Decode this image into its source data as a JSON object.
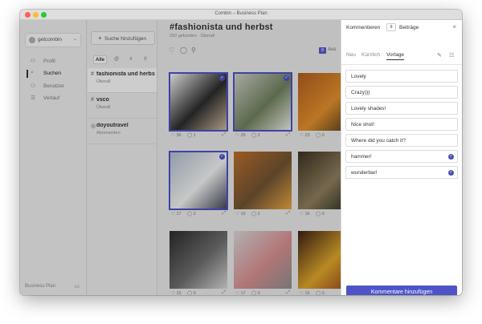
{
  "window": {
    "title": "Combin – Business Plan"
  },
  "sidebar": {
    "account": "getcombin",
    "items": [
      {
        "label": "Profil",
        "icon": "person-icon",
        "glyph": "⚇",
        "active": false
      },
      {
        "label": "Suchen",
        "icon": "search-icon",
        "glyph": "⌕",
        "active": true
      },
      {
        "label": "Benutzer",
        "icon": "users-icon",
        "glyph": "⚇",
        "active": false
      },
      {
        "label": "Verlauf",
        "icon": "list-icon",
        "glyph": "☰",
        "active": false
      }
    ],
    "footer": "Business Plan"
  },
  "searches": {
    "add_label": "Suche hinzufügen",
    "filters": [
      "Alle",
      "@",
      "#",
      "⚲"
    ],
    "items": [
      {
        "prefix": "#",
        "name": "fashionista und herbst",
        "sub": "Überall",
        "active": true
      },
      {
        "prefix": "#",
        "name": "vsco",
        "sub": "Überall",
        "active": false
      },
      {
        "prefix": "◎",
        "name": "doyoutravel",
        "sub": "Abonnenten",
        "active": false
      }
    ]
  },
  "main": {
    "title": "#fashionista und herbst",
    "subtitle": "250 gefunden · Überall",
    "badge": "8",
    "aus": "Aus",
    "posts": [
      {
        "likes": "36",
        "comments": "1",
        "selected": true,
        "colors": [
          "#f2f2f2",
          "#2a2a2a",
          "#c9b79c"
        ]
      },
      {
        "likes": "29",
        "comments": "2",
        "selected": true,
        "colors": [
          "#c8c8c0",
          "#6b7b5a",
          "#e6e6df"
        ]
      },
      {
        "likes": "23",
        "comments": "0",
        "selected": false,
        "colors": [
          "#a85a1f",
          "#d98b2a",
          "#3c2c1c"
        ]
      },
      {
        "likes": "17",
        "comments": "2",
        "selected": true,
        "colors": [
          "#a9b5c3",
          "#e8e8e8",
          "#3b4150"
        ]
      },
      {
        "likes": "19",
        "comments": "2",
        "selected": false,
        "colors": [
          "#b46a2a",
          "#6b5030",
          "#e0a040"
        ]
      },
      {
        "likes": "16",
        "comments": "0",
        "selected": false,
        "colors": [
          "#3a3020",
          "#8a7a5a",
          "#1e2418"
        ]
      },
      {
        "likes": "15",
        "comments": "0",
        "selected": false,
        "colors": [
          "#2a2a2a",
          "#6a6a6a",
          "#cfcfcf"
        ]
      },
      {
        "likes": "17",
        "comments": "0",
        "selected": false,
        "colors": [
          "#cfcfcf",
          "#d08a8a",
          "#8a8a8a"
        ]
      },
      {
        "likes": "16",
        "comments": "0",
        "selected": false,
        "colors": [
          "#3a1f14",
          "#d6a12a",
          "#8a3a1a"
        ]
      }
    ]
  },
  "panel": {
    "header": "Kommentieren",
    "count": "8",
    "header2": "Beiträge",
    "tabs": [
      "Neu",
      "Kürzlich",
      "Vorlage"
    ],
    "active_tab": 2,
    "templates": [
      {
        "text": "Lovely",
        "checked": false
      },
      {
        "text": "Crazy)))",
        "checked": false
      },
      {
        "text": "Lovely shades!",
        "checked": false
      },
      {
        "text": "Nice shot!",
        "checked": false
      },
      {
        "text": "Where did you catch it?",
        "checked": false
      },
      {
        "text": "hammer!",
        "checked": true
      },
      {
        "text": "wunderbar!",
        "checked": true
      }
    ],
    "button": "Kommentare hinzufügen",
    "accent": "#4e54c8"
  }
}
